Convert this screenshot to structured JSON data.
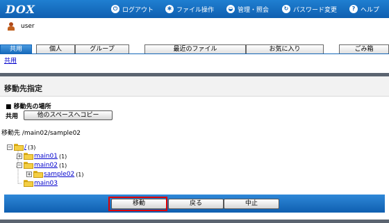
{
  "header": {
    "logo": "DOX",
    "nav": [
      {
        "label": "ログアウト",
        "icon": "logout-icon"
      },
      {
        "label": "ファイル操作",
        "icon": "file-operation-icon"
      },
      {
        "label": "管理・照会",
        "icon": "admin-icon"
      },
      {
        "label": "パスワード変更",
        "icon": "password-refresh-icon"
      },
      {
        "label": "ヘルプ",
        "icon": "help-icon"
      }
    ]
  },
  "user": {
    "name": "user",
    "icon": "user-icon"
  },
  "tabs": [
    {
      "label": "共用",
      "active": true
    },
    {
      "label": "個人",
      "active": false
    },
    {
      "label": "グループ",
      "active": false
    },
    {
      "label": "最近のファイル",
      "active": false
    },
    {
      "label": "お気に入り",
      "active": false
    },
    {
      "label": "ごみ箱",
      "active": false
    }
  ],
  "breadcrumb": "共用",
  "page": {
    "title": "移動先指定",
    "section_heading": "■ 移動先の場所",
    "space_label": "共用",
    "other_space_button": "他のスペースへコピー",
    "destination": "移動先 /main02/sample02"
  },
  "tree": {
    "root": {
      "label": "/",
      "count": "(3)"
    },
    "nodes": [
      {
        "label": "main01",
        "count": "(1)"
      },
      {
        "label": "main02",
        "count": "(1)"
      },
      {
        "label": "sample02",
        "count": "(1)"
      },
      {
        "label": "main03",
        "count": ""
      }
    ]
  },
  "actions": {
    "move": "移動",
    "back": "戻る",
    "cancel": "中止"
  },
  "colors": {
    "brand_blue": "#1266b8",
    "highlight": "#e00000",
    "folder": "#f4cf45"
  }
}
